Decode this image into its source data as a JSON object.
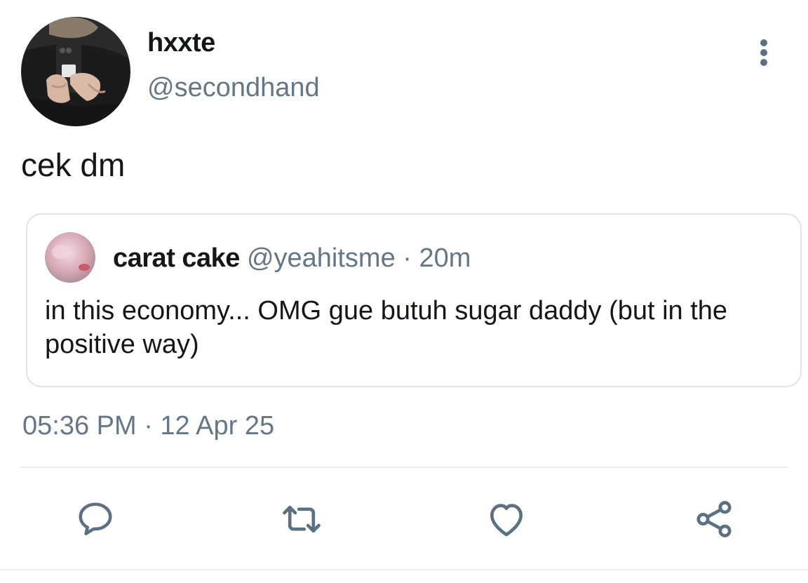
{
  "tweet": {
    "author": {
      "display_name": "hxxte",
      "handle": "@secondhand"
    },
    "text": "cek dm",
    "timestamp": "05:36 PM · 12 Apr 25",
    "more_icon": "more-vertical-icon"
  },
  "quoted_tweet": {
    "author": {
      "display_name": "carat cake",
      "handle": "@yeahitsme"
    },
    "meta": "@yeahitsme · 20m",
    "text": "in this economy... OMG gue butuh sugar daddy (but in the positive way)"
  },
  "actions": [
    {
      "name": "reply",
      "icon": "reply-icon"
    },
    {
      "name": "retweet",
      "icon": "retweet-icon"
    },
    {
      "name": "like",
      "icon": "heart-icon"
    },
    {
      "name": "share",
      "icon": "share-icon"
    }
  ],
  "colors": {
    "text_primary": "#14171a",
    "text_secondary": "#657786",
    "border": "#dfe4e8",
    "icon": "#5b7083"
  }
}
